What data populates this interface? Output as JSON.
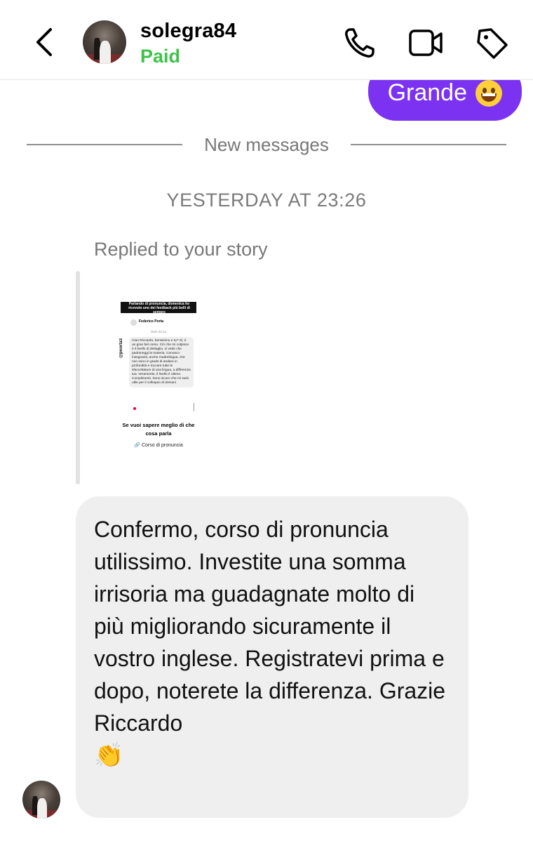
{
  "header": {
    "username": "solegra84",
    "status": "Paid",
    "status_color": "#3ec34a",
    "icons": [
      "chevron-left-icon",
      "phone-icon",
      "video-camera-icon",
      "tag-icon"
    ]
  },
  "sent_message": {
    "text": "Grande",
    "emoji": "grinning-face-emoji",
    "bubble_color": "#7b32f1"
  },
  "divider": {
    "label": "New messages"
  },
  "timestamp": "YESTERDAY AT 23:26",
  "reply_label": "Replied to your story",
  "story": {
    "banner": "Parlando di pronuncia, domenica ho ricevuto uno dei feedback più belli di sempre",
    "chat_name": "Federico Porta",
    "chat_time": "SUN 22:14",
    "handle": "@poorta3",
    "message": "Ciao Riccardo, benissimo e tu? Sì, è un gran bel corso. Ciò che mi colpisce è il livello di dettaglio, si vede che padroneggi la materia. Conosco insegnanti, anche madrelingua, che non sono in grado di andare in profondità e toccare tutte le sfaccettature di una lingua, a differenza tua. Veramente, il livello è ottimo. Complimenti. Sono sicuro che mi sarà utile per il colloquio di domani",
    "caption": "Se vuoi sapere meglio di che cosa parla",
    "link": "Corso di pronuncia"
  },
  "received_message": {
    "text": "Confermo, corso di pronuncia utilissimo. Investite una somma irrisoria ma guadagnate molto di più migliorando sicuramente il vostro inglese. Registratevi prima e dopo, noterete la differenza. Grazie Riccardo",
    "emoji": "clapping-hands-emoji"
  }
}
